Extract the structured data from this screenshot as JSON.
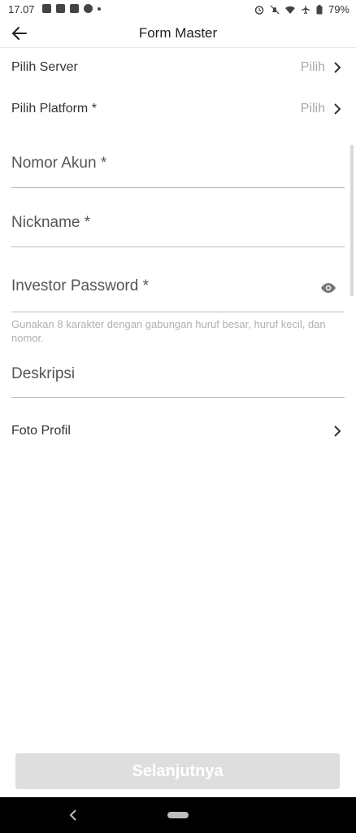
{
  "status_bar": {
    "time": "17.07",
    "battery": "79%"
  },
  "app_bar": {
    "title": "Form Master"
  },
  "form": {
    "server": {
      "label": "Pilih Server",
      "value": "Pilih"
    },
    "platform": {
      "label": "Pilih Platform *",
      "value": "Pilih"
    },
    "account_number": {
      "placeholder": "Nomor Akun *"
    },
    "nickname": {
      "placeholder": "Nickname *"
    },
    "investor_password": {
      "placeholder": "Investor Password *",
      "hint": "Gunakan 8 karakter dengan gabungan huruf besar, huruf kecil, dan nomor."
    },
    "description": {
      "placeholder": "Deskripsi"
    },
    "profile_photo": {
      "label": "Foto Profil"
    }
  },
  "actions": {
    "next_label": "Selanjutnya"
  },
  "colors": {
    "disabled_button": "#dedede",
    "hint_text": "#b0b0b0",
    "divider": "#bdbdbd"
  }
}
